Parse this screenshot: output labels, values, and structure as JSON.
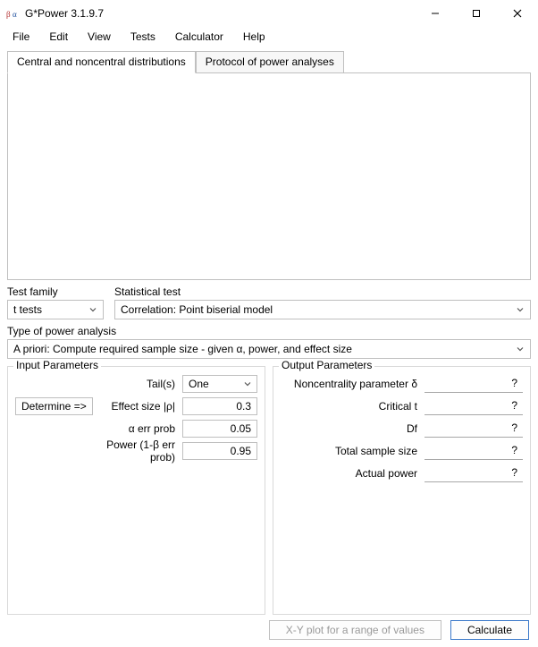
{
  "titlebar": {
    "title": "G*Power 3.1.9.7"
  },
  "menu": {
    "file": "File",
    "edit": "Edit",
    "view": "View",
    "tests": "Tests",
    "calculator": "Calculator",
    "help": "Help"
  },
  "tabs": {
    "central": "Central and noncentral distributions",
    "protocol": "Protocol of power analyses"
  },
  "test_family": {
    "label": "Test family",
    "value": "t tests"
  },
  "stat_test": {
    "label": "Statistical test",
    "value": "Correlation: Point biserial model"
  },
  "analysis_type": {
    "label": "Type of power analysis",
    "value": "A priori: Compute required sample size - given α, power, and effect size"
  },
  "input": {
    "title": "Input Parameters",
    "determine": "Determine =>",
    "tails_label": "Tail(s)",
    "tails_value": "One",
    "effect_label": "Effect size |ρ|",
    "effect_value": "0.3",
    "alpha_label": "α err prob",
    "alpha_value": "0.05",
    "power_label": "Power (1-β err prob)",
    "power_value": "0.95"
  },
  "output": {
    "title": "Output Parameters",
    "ncp_label": "Noncentrality parameter δ",
    "ncp_value": "?",
    "crit_label": "Critical t",
    "crit_value": "?",
    "df_label": "Df",
    "df_value": "?",
    "n_label": "Total sample size",
    "n_value": "?",
    "ap_label": "Actual power",
    "ap_value": "?"
  },
  "buttons": {
    "xyplot": "X-Y plot for a range of values",
    "calculate": "Calculate"
  }
}
